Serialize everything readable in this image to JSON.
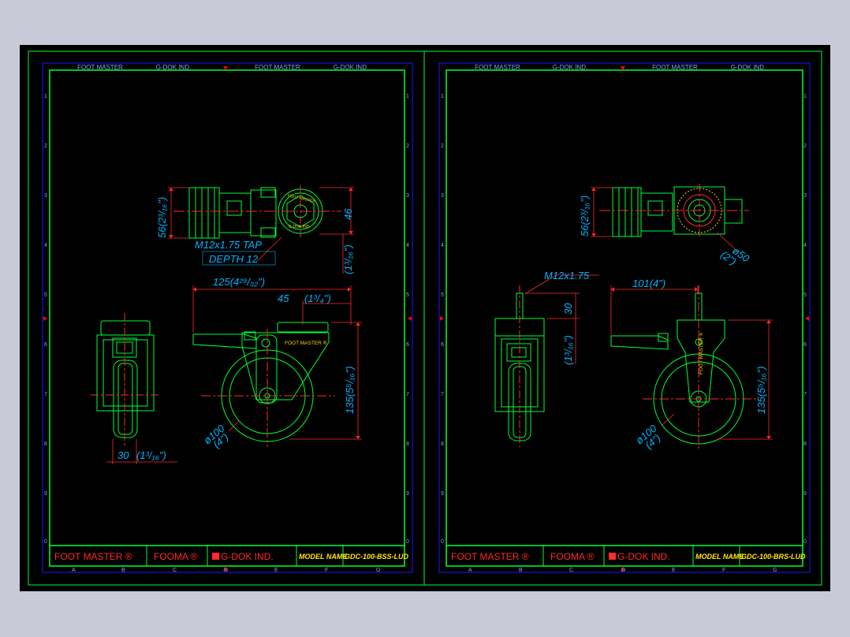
{
  "header_labels": [
    "FOOT MASTER",
    "G-DOK IND.",
    "FOOT MASTER",
    "G-DOK IND."
  ],
  "row_numbers": [
    "1",
    "2",
    "3",
    "4",
    "5",
    "6",
    "7",
    "8",
    "9",
    "0"
  ],
  "column_letters": [
    "A",
    "B",
    "C",
    "D",
    "E",
    "F",
    "G"
  ],
  "colors": {
    "frame": "#00ff33",
    "border": "#1a1aff",
    "dimension": "#00b4ff",
    "title_text": "#ff2a2a",
    "highlight": "#ffea00",
    "background": "#000000",
    "outer": "#c8cad8"
  },
  "sheets": {
    "left": {
      "dims": {
        "top_height": "56(2³/₁₆\")",
        "tap": "M12x1.75 TAP",
        "depth": "DEPTH 12",
        "side_height": "46",
        "side_inch": "(1³/₁₆\")",
        "overall": "125(4²⁹/₃₂\")",
        "offset": "45",
        "offset_inch": "(1³/₄\")",
        "height": "135(5⁵/₁₆\")",
        "diameter": "ø100",
        "diameter_inch": "(4\")",
        "width": "30",
        "width_inch": "(1³/₁₆\")"
      },
      "body_label": "FOOT MASTER ®",
      "title_block": {
        "brand": "FOOT MASTER ®",
        "fooma": "FOOMA ®",
        "company": "G-DOK IND.",
        "model_label": "MODEL NAME",
        "model_value": "GDC-100-BSS-LUD"
      }
    },
    "right": {
      "dims": {
        "top_height": "56(2³/₁₆\")",
        "plate": "ø50",
        "plate_inch": "(2\")",
        "thread": "M12x1.75",
        "stem": "30",
        "stem_inch": "(1³/₁₆\")",
        "overall": "101(4\")",
        "height": "135(5⁵/₁₆\")",
        "diameter": "ø100",
        "diameter_inch": "(4\")"
      },
      "body_label": "FOOT MASTER ®",
      "title_block": {
        "brand": "FOOT MASTER ®",
        "fooma": "FOOMA ®",
        "company": "G-DOK IND.",
        "model_label": "MODEL NAME",
        "model_value": "GDC-100-BRS-LUD"
      }
    }
  }
}
